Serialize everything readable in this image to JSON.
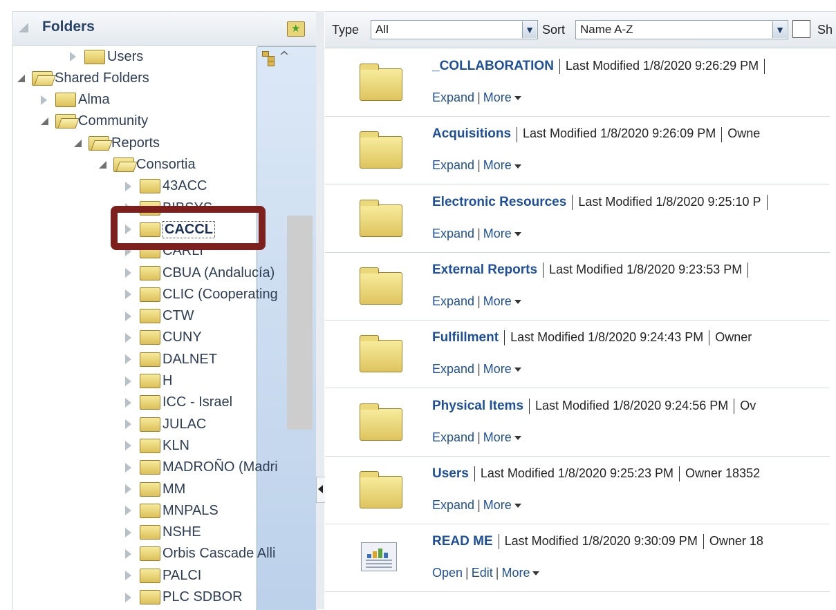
{
  "left": {
    "title": "Folders",
    "tree": [
      {
        "label": "Users",
        "level": 2,
        "state": "collapsed"
      },
      {
        "label": "Shared Folders",
        "level": 0,
        "state": "expanded"
      },
      {
        "label": "Alma",
        "level": 1,
        "state": "collapsed"
      },
      {
        "label": "Community",
        "level": 1,
        "state": "expanded"
      },
      {
        "label": "Reports",
        "level": 2,
        "state": "expanded"
      },
      {
        "label": "Consortia",
        "level": 3,
        "state": "expanded"
      },
      {
        "label": "43ACC",
        "level": 4,
        "state": "collapsed"
      },
      {
        "label": "BIBSYS",
        "level": 4,
        "state": "collapsed"
      },
      {
        "label": "CACCL",
        "level": 4,
        "state": "collapsed",
        "selected": true
      },
      {
        "label": "CARLI",
        "level": 4,
        "state": "collapsed"
      },
      {
        "label": "CBUA (Andalucía)",
        "level": 4,
        "state": "collapsed"
      },
      {
        "label": "CLIC (Cooperating",
        "level": 4,
        "state": "collapsed"
      },
      {
        "label": "CTW",
        "level": 4,
        "state": "collapsed"
      },
      {
        "label": "CUNY",
        "level": 4,
        "state": "collapsed"
      },
      {
        "label": "DALNET",
        "level": 4,
        "state": "collapsed"
      },
      {
        "label": "H",
        "level": 4,
        "state": "collapsed"
      },
      {
        "label": "ICC - Israel",
        "level": 4,
        "state": "collapsed"
      },
      {
        "label": "JULAC",
        "level": 4,
        "state": "collapsed"
      },
      {
        "label": "KLN",
        "level": 4,
        "state": "collapsed"
      },
      {
        "label": "MADROÑO (Madri",
        "level": 4,
        "state": "collapsed"
      },
      {
        "label": "MM",
        "level": 4,
        "state": "collapsed"
      },
      {
        "label": "MNPALS",
        "level": 4,
        "state": "collapsed"
      },
      {
        "label": "NSHE",
        "level": 4,
        "state": "collapsed"
      },
      {
        "label": "Orbis Cascade Alli",
        "level": 4,
        "state": "collapsed"
      },
      {
        "label": "PALCI",
        "level": 4,
        "state": "collapsed"
      },
      {
        "label": "PLC SDBOR",
        "level": 4,
        "state": "collapsed"
      }
    ]
  },
  "toolbar": {
    "type_label": "Type",
    "type_value": "All",
    "sort_label": "Sort",
    "sort_value": "Name A-Z",
    "show_label": "Sh"
  },
  "items": [
    {
      "name": "_COLLABORATION",
      "meta": "Last Modified 1/8/2020 9:26:29 PM",
      "extra": "",
      "icon": "folder",
      "actions": [
        "Expand",
        "More"
      ]
    },
    {
      "name": "Acquisitions",
      "meta": "Last Modified 1/8/2020 9:26:09 PM",
      "extra": "Owne",
      "icon": "folder",
      "actions": [
        "Expand",
        "More"
      ]
    },
    {
      "name": "Electronic Resources",
      "meta": "Last Modified 1/8/2020 9:25:10 P",
      "extra": "",
      "icon": "folder",
      "actions": [
        "Expand",
        "More"
      ]
    },
    {
      "name": "External Reports",
      "meta": "Last Modified 1/8/2020 9:23:53 PM",
      "extra": "",
      "icon": "folder",
      "actions": [
        "Expand",
        "More"
      ]
    },
    {
      "name": "Fulfillment",
      "meta": "Last Modified 1/8/2020 9:24:43 PM",
      "extra": "Owner",
      "icon": "folder",
      "actions": [
        "Expand",
        "More"
      ]
    },
    {
      "name": "Physical Items",
      "meta": "Last Modified 1/8/2020 9:24:56 PM",
      "extra": "Ov",
      "icon": "folder",
      "actions": [
        "Expand",
        "More"
      ]
    },
    {
      "name": "Users",
      "meta": "Last Modified 1/8/2020 9:25:23 PM",
      "extra": "Owner 18352",
      "icon": "folder",
      "actions": [
        "Expand",
        "More"
      ]
    },
    {
      "name": "READ ME",
      "meta": "Last Modified 1/8/2020 9:30:09 PM",
      "extra": "Owner 18",
      "icon": "report",
      "actions": [
        "Open",
        "Edit",
        "More"
      ]
    }
  ],
  "colors": {
    "link": "#1e4f9c",
    "highlight": "#7d1f1c",
    "folder": "#e4cc66"
  }
}
